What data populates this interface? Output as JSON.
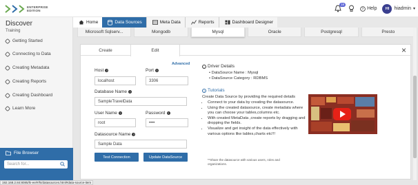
{
  "app": {
    "logo_line1": "ENTERPRISE",
    "logo_line2": "EDITION",
    "notifications_count": "18",
    "help_label": "Help",
    "user_initials": "HI",
    "user_name": "hiadmin"
  },
  "sidebar": {
    "title": "Discover",
    "subtitle": "Training",
    "items": [
      {
        "label": "Getting Started"
      },
      {
        "label": "Connecting to Data"
      },
      {
        "label": "Creating Metadata"
      },
      {
        "label": "Creating Reports"
      },
      {
        "label": "Creating Dashboard"
      },
      {
        "label": "Learn More"
      }
    ],
    "file_browser_label": "File Browser",
    "search_placeholder": "Search for..."
  },
  "breadcrumb": [
    {
      "label": "Home"
    },
    {
      "label": "Data Sources"
    },
    {
      "label": "Meta Data"
    },
    {
      "label": "Reports"
    },
    {
      "label": "Dashboard Designer"
    }
  ],
  "datasource_tabs": [
    "Microsoft Sqlserv...",
    "Mongodb",
    "Mysql",
    "Oracle",
    "Postgresql",
    "Presto"
  ],
  "modal": {
    "tab_create": "Create",
    "tab_edit": "Edit",
    "close_symbol": "×",
    "advanced_label": "Advanced",
    "host_label": "Host",
    "host_value": "localhost",
    "port_label": "Port",
    "port_value": "3306",
    "dbname_label": "Database Name",
    "dbname_value": "SampleTravelData",
    "username_label": "User Name",
    "username_value": "root",
    "password_label": "Password",
    "password_value": "••••",
    "dsname_label": "Datasource Name",
    "dsname_value": "Sample Data",
    "test_button": "Test Connection",
    "update_button": "Update DataSource"
  },
  "driver": {
    "heading": "Driver Details",
    "name_line": "DataSource Name : Mysql",
    "category_line": "DataSource Category : RDBMS"
  },
  "tutorials": {
    "heading": "Tutorials",
    "intro": "Create Data Source by providing the required details",
    "bullets": [
      "Connect to your data by creating the datasource.",
      "Using the created datasource, create metadata where you can choose your tables,columns etc.",
      "With created MetaData ,create reports by dragging and dropping the fields.",
      "Visualize and get insight of the data effectively with various options like tables,charts etc!!!"
    ],
    "note": "**Share the datasource with various users, roles and organizations."
  },
  "status_url": "192.168.2.84:8085/hi-ee/#/hi/datasources.html#data-source-item"
}
